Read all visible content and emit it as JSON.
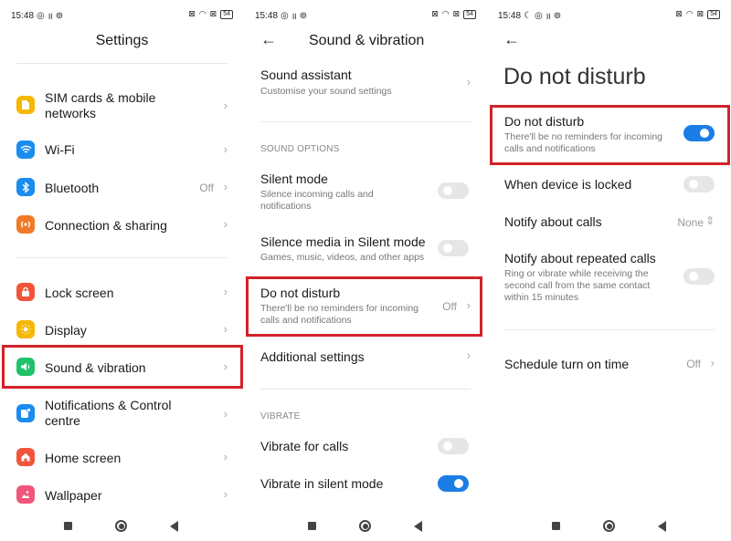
{
  "status": {
    "time": "15:48",
    "battery": "54"
  },
  "settings": {
    "title": "Settings",
    "items": [
      {
        "label": "SIM cards & mobile networks",
        "icon": "sim-icon",
        "color": "#f5b700"
      },
      {
        "label": "Wi-Fi",
        "icon": "wifi-icon",
        "color": "#1a8cf0"
      },
      {
        "label": "Bluetooth",
        "icon": "bluetooth-icon",
        "color": "#1a8cf0",
        "value": "Off"
      },
      {
        "label": "Connection & sharing",
        "icon": "connection-icon",
        "color": "#f07a28"
      },
      {
        "label": "Lock screen",
        "icon": "lock-icon",
        "color": "#f0553a"
      },
      {
        "label": "Display",
        "icon": "display-icon",
        "color": "#f5b700"
      },
      {
        "label": "Sound & vibration",
        "icon": "sound-icon",
        "color": "#1fc26a"
      },
      {
        "label": "Notifications & Control centre",
        "icon": "notifications-icon",
        "color": "#1a8cf0"
      },
      {
        "label": "Home screen",
        "icon": "home-icon",
        "color": "#f0553a"
      },
      {
        "label": "Wallpaper",
        "icon": "wallpaper-icon",
        "color": "#f0557a"
      }
    ]
  },
  "sound": {
    "title": "Sound & vibration",
    "assistant": {
      "title": "Sound assistant",
      "sub": "Customise your sound settings"
    },
    "section_options": "SOUND OPTIONS",
    "silent": {
      "title": "Silent mode",
      "sub": "Silence incoming calls and notifications"
    },
    "silence_media": {
      "title": "Silence media in Silent mode",
      "sub": "Games, music, videos, and other apps"
    },
    "dnd": {
      "title": "Do not disturb",
      "sub": "There'll be no reminders for incoming calls and notifications",
      "value": "Off"
    },
    "additional": {
      "title": "Additional settings"
    },
    "section_vibrate": "VIBRATE",
    "vibrate_calls": {
      "title": "Vibrate for calls"
    },
    "vibrate_silent": {
      "title": "Vibrate in silent mode"
    }
  },
  "dnd_page": {
    "title": "Do not disturb",
    "main": {
      "title": "Do not disturb",
      "sub": "There'll be no reminders for incoming calls and notifications"
    },
    "locked": {
      "title": "When device is locked"
    },
    "calls": {
      "title": "Notify about calls",
      "value": "None"
    },
    "repeated": {
      "title": "Notify about repeated calls",
      "sub": "Ring or vibrate while receiving the second call from the same contact within 15 minutes"
    },
    "schedule": {
      "title": "Schedule turn on time",
      "value": "Off"
    }
  },
  "colors": {
    "highlight": "#d3222a",
    "toggle_on": "#1a7ee6"
  }
}
